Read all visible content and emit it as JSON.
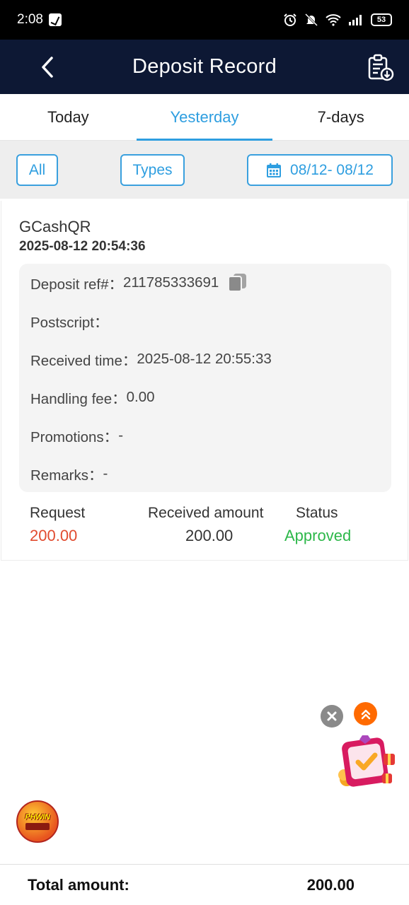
{
  "status_bar": {
    "time": "2:08",
    "battery": "53"
  },
  "header": {
    "title": "Deposit Record"
  },
  "tabs": [
    {
      "label": "Today",
      "active": false
    },
    {
      "label": "Yesterday",
      "active": true
    },
    {
      "label": "7-days",
      "active": false
    }
  ],
  "filters": {
    "all_label": "All",
    "types_label": "Types",
    "date_range": "08/12- 08/12"
  },
  "record": {
    "type": "GCashQR",
    "datetime": "2025-08-12 20:54:36",
    "deposit_ref_label": "Deposit ref#：",
    "deposit_ref": "211785333691",
    "postscript_label": "Postscript：",
    "postscript": "",
    "received_time_label": "Received time：",
    "received_time": "2025-08-12 20:55:33",
    "handling_fee_label": "Handling fee：",
    "handling_fee": "0.00",
    "promotions_label": "Promotions：",
    "promotions": "-",
    "remarks_label": "Remarks：",
    "remarks": "-",
    "request_label": "Request",
    "request_amount": "200.00",
    "received_amount_label": "Received amount",
    "received_amount": "200.00",
    "status_label": "Status",
    "status": "Approved"
  },
  "footer": {
    "total_label": "Total amount:",
    "total_value": "200.00"
  },
  "colors": {
    "header_bg": "#0d1834",
    "accent": "#2e9ee0",
    "request_red": "#e14b2f",
    "approved_green": "#2db84a"
  },
  "logo_text": "PHWIN"
}
